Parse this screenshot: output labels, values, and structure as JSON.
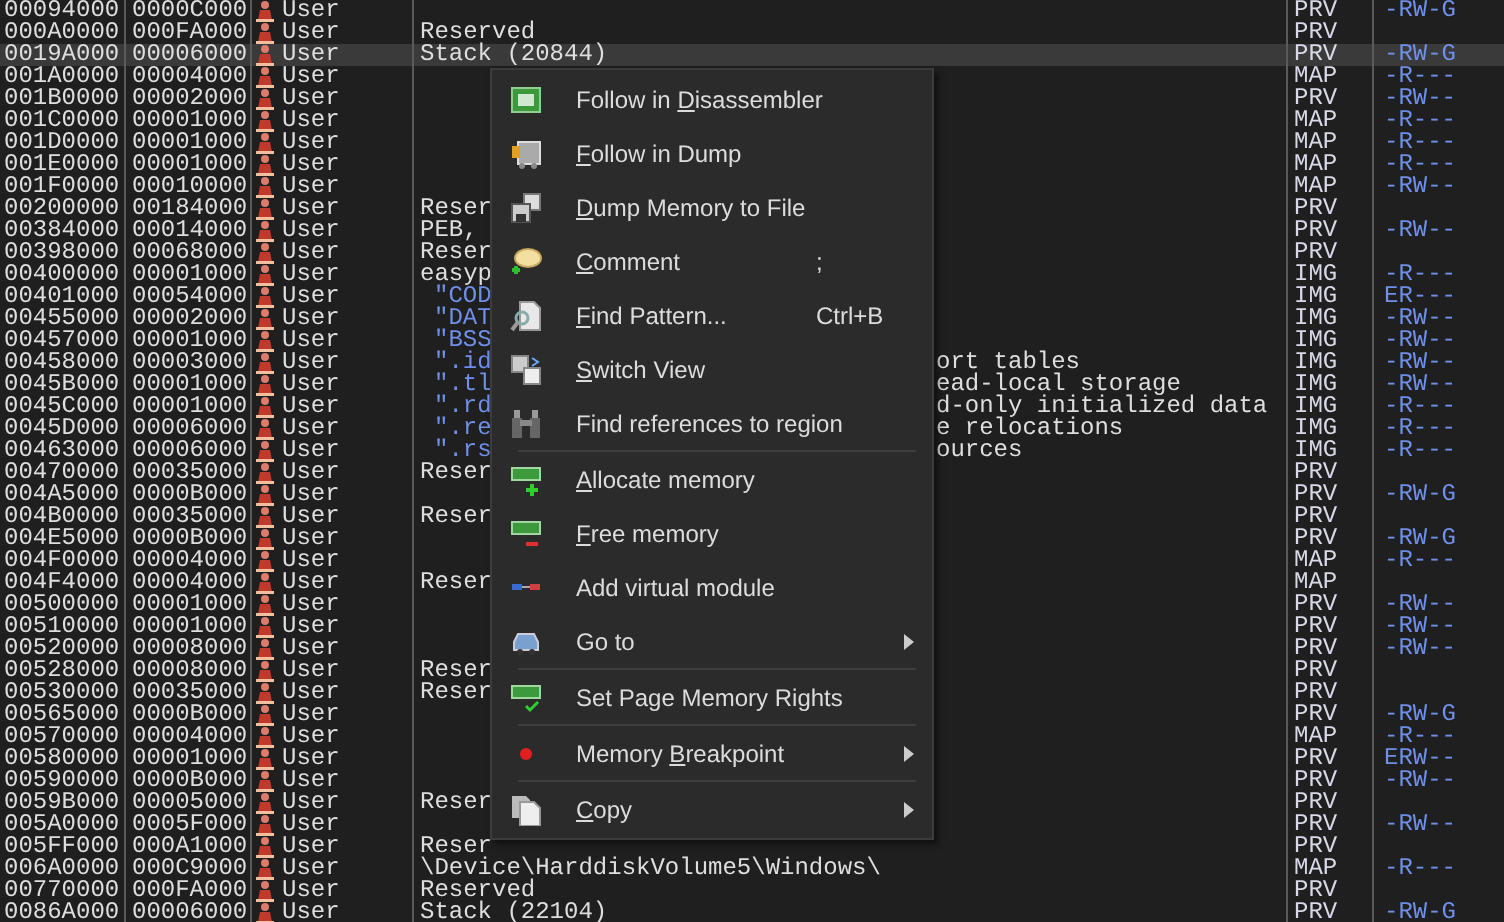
{
  "memory_map": {
    "rows": [
      {
        "address": "00094000",
        "size": "0000C000",
        "owner": "User",
        "info": "",
        "type": "PRV",
        "protection": "-RW-G",
        "selected": false
      },
      {
        "address": "000A0000",
        "size": "000FA000",
        "owner": "User",
        "info": "Reserved",
        "type": "PRV",
        "protection": "",
        "selected": false
      },
      {
        "address": "0019A000",
        "size": "00006000",
        "owner": "User",
        "info": "Stack (20844)",
        "type": "PRV",
        "protection": "-RW-G",
        "selected": true
      },
      {
        "address": "001A0000",
        "size": "00004000",
        "owner": "User",
        "info": "",
        "type": "MAP",
        "protection": "-R---",
        "selected": false
      },
      {
        "address": "001B0000",
        "size": "00002000",
        "owner": "User",
        "info": "",
        "type": "PRV",
        "protection": "-RW--",
        "selected": false
      },
      {
        "address": "001C0000",
        "size": "00001000",
        "owner": "User",
        "info": "",
        "type": "MAP",
        "protection": "-R---",
        "selected": false
      },
      {
        "address": "001D0000",
        "size": "00001000",
        "owner": "User",
        "info": "",
        "type": "MAP",
        "protection": "-R---",
        "selected": false
      },
      {
        "address": "001E0000",
        "size": "00001000",
        "owner": "User",
        "info": "",
        "type": "MAP",
        "protection": "-R---",
        "selected": false
      },
      {
        "address": "001F0000",
        "size": "00010000",
        "owner": "User",
        "info": "",
        "type": "MAP",
        "protection": "-RW--",
        "selected": false
      },
      {
        "address": "00200000",
        "size": "00184000",
        "owner": "User",
        "info": "Reser",
        "type": "PRV",
        "protection": "",
        "selected": false
      },
      {
        "address": "00384000",
        "size": "00014000",
        "owner": "User",
        "info": "PEB,",
        "type": "PRV",
        "protection": "-RW--",
        "selected": false
      },
      {
        "address": "00398000",
        "size": "00068000",
        "owner": "User",
        "info": "Reser",
        "type": "PRV",
        "protection": "",
        "selected": false
      },
      {
        "address": "00400000",
        "size": "00001000",
        "owner": "User",
        "info": "easyp",
        "type": "IMG",
        "protection": "-R---",
        "selected": false
      },
      {
        "address": "00401000",
        "size": "00054000",
        "owner": "User",
        "kind": "section",
        "info": "\"COD",
        "type": "IMG",
        "protection": "ER---",
        "selected": false
      },
      {
        "address": "00455000",
        "size": "00002000",
        "owner": "User",
        "kind": "section",
        "info": "\"DAT",
        "type": "IMG",
        "protection": "-RW--",
        "selected": false
      },
      {
        "address": "00457000",
        "size": "00001000",
        "owner": "User",
        "kind": "section",
        "info": "\"BSS",
        "type": "IMG",
        "protection": "-RW--",
        "selected": false
      },
      {
        "address": "00458000",
        "size": "00003000",
        "owner": "User",
        "kind": "section",
        "info": "\".id",
        "info_tail": "ort tables",
        "type": "IMG",
        "protection": "-RW--",
        "selected": false
      },
      {
        "address": "0045B000",
        "size": "00001000",
        "owner": "User",
        "kind": "section",
        "info": "\".tl",
        "info_tail": "ead-local storage",
        "type": "IMG",
        "protection": "-RW--",
        "selected": false
      },
      {
        "address": "0045C000",
        "size": "00001000",
        "owner": "User",
        "kind": "section",
        "info": "\".rd",
        "info_tail": "d-only initialized data",
        "type": "IMG",
        "protection": "-R---",
        "selected": false
      },
      {
        "address": "0045D000",
        "size": "00006000",
        "owner": "User",
        "kind": "section",
        "info": "\".re",
        "info_tail": "e relocations",
        "type": "IMG",
        "protection": "-R---",
        "selected": false
      },
      {
        "address": "00463000",
        "size": "00006000",
        "owner": "User",
        "kind": "section",
        "info": "\".rs",
        "info_tail": "ources",
        "type": "IMG",
        "protection": "-R---",
        "selected": false
      },
      {
        "address": "00470000",
        "size": "00035000",
        "owner": "User",
        "info": "Reser",
        "type": "PRV",
        "protection": "",
        "selected": false
      },
      {
        "address": "004A5000",
        "size": "0000B000",
        "owner": "User",
        "info": "",
        "type": "PRV",
        "protection": "-RW-G",
        "selected": false
      },
      {
        "address": "004B0000",
        "size": "00035000",
        "owner": "User",
        "info": "Reser",
        "type": "PRV",
        "protection": "",
        "selected": false
      },
      {
        "address": "004E5000",
        "size": "0000B000",
        "owner": "User",
        "info": "",
        "type": "PRV",
        "protection": "-RW-G",
        "selected": false
      },
      {
        "address": "004F0000",
        "size": "00004000",
        "owner": "User",
        "info": "",
        "type": "MAP",
        "protection": "-R---",
        "selected": false
      },
      {
        "address": "004F4000",
        "size": "00004000",
        "owner": "User",
        "info": "Reser",
        "type": "MAP",
        "protection": "",
        "selected": false
      },
      {
        "address": "00500000",
        "size": "00001000",
        "owner": "User",
        "info": "",
        "type": "PRV",
        "protection": "-RW--",
        "selected": false
      },
      {
        "address": "00510000",
        "size": "00001000",
        "owner": "User",
        "info": "",
        "type": "PRV",
        "protection": "-RW--",
        "selected": false
      },
      {
        "address": "00520000",
        "size": "00008000",
        "owner": "User",
        "info": "",
        "type": "PRV",
        "protection": "-RW--",
        "selected": false
      },
      {
        "address": "00528000",
        "size": "00008000",
        "owner": "User",
        "info": "Reser",
        "type": "PRV",
        "protection": "",
        "selected": false
      },
      {
        "address": "00530000",
        "size": "00035000",
        "owner": "User",
        "info": "Reser",
        "type": "PRV",
        "protection": "",
        "selected": false
      },
      {
        "address": "00565000",
        "size": "0000B000",
        "owner": "User",
        "info": "",
        "type": "PRV",
        "protection": "-RW-G",
        "selected": false
      },
      {
        "address": "00570000",
        "size": "00004000",
        "owner": "User",
        "info": "",
        "type": "MAP",
        "protection": "-R---",
        "selected": false
      },
      {
        "address": "00580000",
        "size": "00001000",
        "owner": "User",
        "info": "",
        "type": "PRV",
        "protection": "ERW--",
        "selected": false
      },
      {
        "address": "00590000",
        "size": "0000B000",
        "owner": "User",
        "info": "",
        "type": "PRV",
        "protection": "-RW--",
        "selected": false
      },
      {
        "address": "0059B000",
        "size": "00005000",
        "owner": "User",
        "info": "Reser",
        "type": "PRV",
        "protection": "",
        "selected": false
      },
      {
        "address": "005A0000",
        "size": "0005F000",
        "owner": "User",
        "info": "",
        "type": "PRV",
        "protection": "-RW--",
        "selected": false
      },
      {
        "address": "005FF000",
        "size": "000A1000",
        "owner": "User",
        "info": "Reser",
        "type": "PRV",
        "protection": "",
        "selected": false
      },
      {
        "address": "006A0000",
        "size": "000C9000",
        "owner": "User",
        "info": "\\Device\\HarddiskVolume5\\Windows\\",
        "type": "MAP",
        "protection": "-R---",
        "selected": false
      },
      {
        "address": "00770000",
        "size": "000FA000",
        "owner": "User",
        "info": "Reserved",
        "type": "PRV",
        "protection": "",
        "selected": false
      },
      {
        "address": "0086A000",
        "size": "00006000",
        "owner": "User",
        "info": "Stack (22104)",
        "type": "PRV",
        "protection": "-RW-G",
        "selected": false
      }
    ]
  },
  "context_menu": {
    "items": [
      {
        "kind": "item",
        "label_pre": "Follow in ",
        "key": "D",
        "label_post": "isassembler"
      },
      {
        "kind": "item",
        "key": "F",
        "label_post": "ollow in Dump"
      },
      {
        "kind": "item",
        "key": "D",
        "label_post": "ump Memory to File"
      },
      {
        "kind": "item",
        "key": "C",
        "label_post": "omment",
        "shortcut": ";"
      },
      {
        "kind": "item",
        "key": "F",
        "label_post": "ind Pattern...",
        "shortcut": "Ctrl+B"
      },
      {
        "kind": "item",
        "key": "S",
        "label_post": "witch View"
      },
      {
        "kind": "item",
        "label_pre": "Find references to region"
      },
      {
        "kind": "separator"
      },
      {
        "kind": "item",
        "key": "A",
        "label_post": "llocate memory"
      },
      {
        "kind": "item",
        "key": "F",
        "label_post": "ree memory"
      },
      {
        "kind": "item",
        "label_pre": "Add virtual module"
      },
      {
        "kind": "item",
        "label_pre": "Go to",
        "submenu": true
      },
      {
        "kind": "separator"
      },
      {
        "kind": "item",
        "label_pre": "Set Page Memory Rights"
      },
      {
        "kind": "separator"
      },
      {
        "kind": "item",
        "label_pre": "Memory ",
        "key": "B",
        "label_post": "reakpoint",
        "submenu": true
      },
      {
        "kind": "separator"
      },
      {
        "kind": "item",
        "key": "C",
        "label_post": "opy",
        "submenu": true
      }
    ]
  }
}
